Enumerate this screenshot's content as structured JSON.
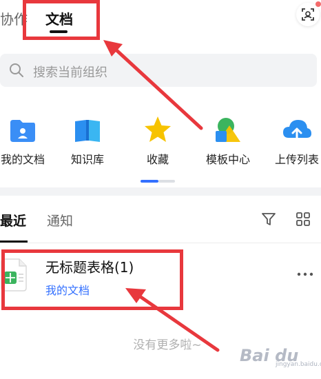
{
  "header": {
    "tabs": [
      {
        "label": "协作"
      },
      {
        "label": "文档"
      }
    ],
    "scan_icon": "scan-icon"
  },
  "search": {
    "placeholder": "搜索当前组织"
  },
  "quick_access": [
    {
      "label": "我的文档",
      "icon": "folder-user-icon",
      "color": "#3a8ef6"
    },
    {
      "label": "知识库",
      "icon": "book-icon",
      "color": "#2b8ff0"
    },
    {
      "label": "收藏",
      "icon": "star-icon",
      "color": "#f7c300"
    },
    {
      "label": "模板中心",
      "icon": "shapes-icon",
      "color": "#3bb45e"
    },
    {
      "label": "上传列表",
      "icon": "cloud-upload-icon",
      "color": "#2b8ff0"
    }
  ],
  "list_tabs": {
    "recent": "最近",
    "notify": "通知"
  },
  "documents": [
    {
      "title": "无标题表格(1)",
      "location": "我的文档",
      "icon": "spreadsheet-icon"
    }
  ],
  "footer": {
    "no_more": "没有更多啦~"
  },
  "watermark": {
    "text": "Bai du",
    "sub": "jingyan.baidu.com"
  },
  "colors": {
    "accent": "#3370ff",
    "annotation": "#e8383d"
  }
}
